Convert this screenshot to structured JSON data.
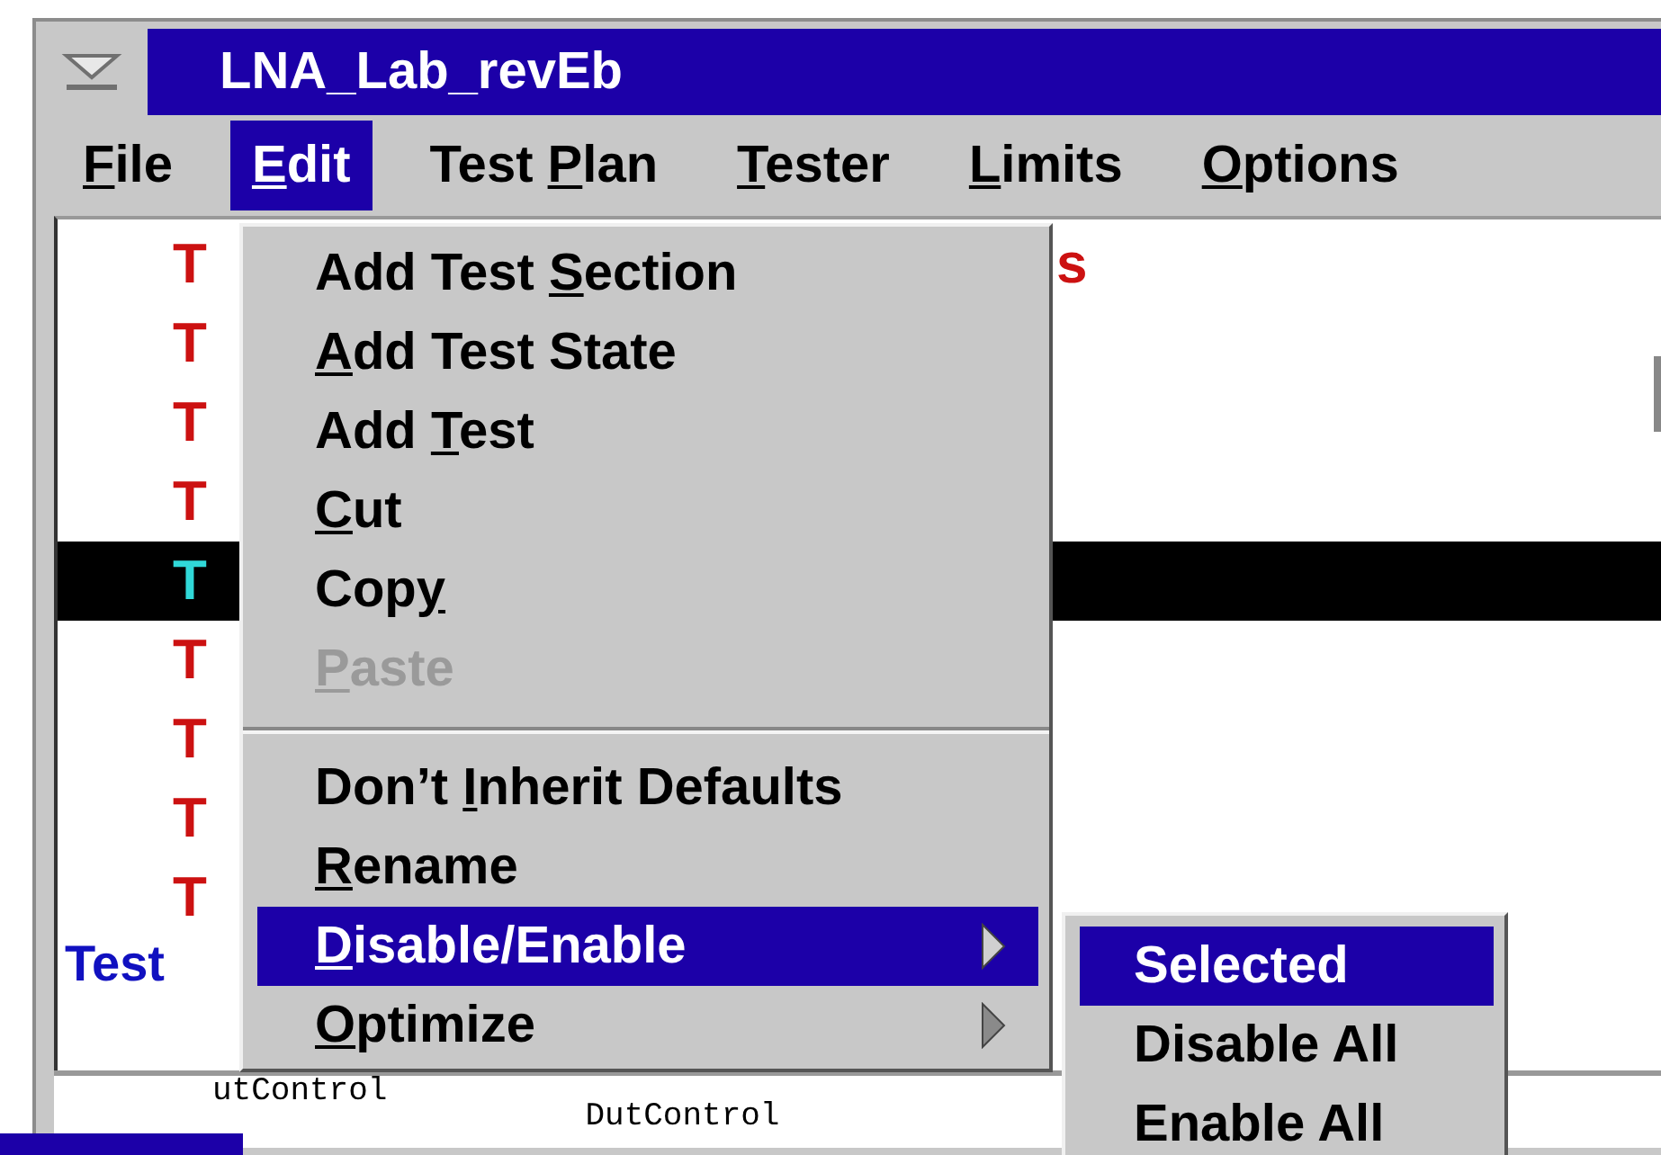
{
  "window": {
    "title": "LNA_Lab_revEb"
  },
  "menubar": [
    {
      "key": "F",
      "after": "ile",
      "selected": false
    },
    {
      "key": "E",
      "after": "dit",
      "selected": true
    },
    {
      "before": "Test ",
      "key": "P",
      "after": "lan",
      "selected": false
    },
    {
      "key": "T",
      "after": "ester",
      "selected": false
    },
    {
      "key": "L",
      "after": "imits",
      "selected": false
    },
    {
      "key": "O",
      "after": "ptions",
      "selected": false
    }
  ],
  "tree": {
    "child_rows": [
      {
        "text": "T",
        "tail": "s",
        "color": "#cc1111",
        "selected": false
      },
      {
        "text": "T",
        "color": "#cc1111",
        "selected": false
      },
      {
        "text": "T",
        "color": "#cc1111",
        "selected": false
      },
      {
        "text": "T",
        "color": "#cc1111",
        "selected": false
      },
      {
        "text": "T",
        "selected": true
      },
      {
        "text": "T",
        "color": "#cc1111",
        "selected": false
      },
      {
        "text": "T",
        "color": "#cc1111",
        "selected": false
      },
      {
        "text": "T",
        "color": "#cc1111",
        "selected": false
      },
      {
        "text": "T",
        "color": "#cc1111",
        "selected": false
      }
    ],
    "rows": [
      {
        "text": "Test",
        "color": "#1010c0",
        "selected": false
      }
    ]
  },
  "bottom_panel": {
    "left_text": "utControl",
    "right_text": "DutControl"
  },
  "edit_menu": {
    "items": [
      {
        "kind": "item",
        "before": "Add Test ",
        "key": "S",
        "after": "ection",
        "disabled": false,
        "selected": false
      },
      {
        "kind": "item",
        "key": "A",
        "after": "dd Test State",
        "disabled": false,
        "selected": false
      },
      {
        "kind": "item",
        "before": "Add ",
        "key": "T",
        "after": "est",
        "disabled": false,
        "selected": false
      },
      {
        "kind": "item",
        "key": "C",
        "after": "ut",
        "disabled": false,
        "selected": false
      },
      {
        "kind": "item",
        "before": "Cop",
        "key": "y",
        "disabled": false,
        "selected": false
      },
      {
        "kind": "item",
        "key": "P",
        "after": "aste",
        "disabled": true,
        "selected": false
      },
      {
        "kind": "separator"
      },
      {
        "kind": "item",
        "before": "Don’t ",
        "key": "I",
        "after": "nherit Defaults",
        "disabled": false,
        "selected": false
      },
      {
        "kind": "item",
        "key": "R",
        "after": "ename",
        "disabled": false,
        "selected": false
      },
      {
        "kind": "item",
        "key": "D",
        "after": "isable/Enable",
        "disabled": false,
        "selected": true,
        "submenu": true
      },
      {
        "kind": "item",
        "key": "O",
        "after": "ptimize",
        "disabled": false,
        "selected": false,
        "submenu": true
      }
    ]
  },
  "submenu": {
    "items": [
      {
        "label": "Selected",
        "selected": true
      },
      {
        "label": "Disable All",
        "selected": false
      },
      {
        "label": "Enable All",
        "selected": false
      }
    ]
  }
}
